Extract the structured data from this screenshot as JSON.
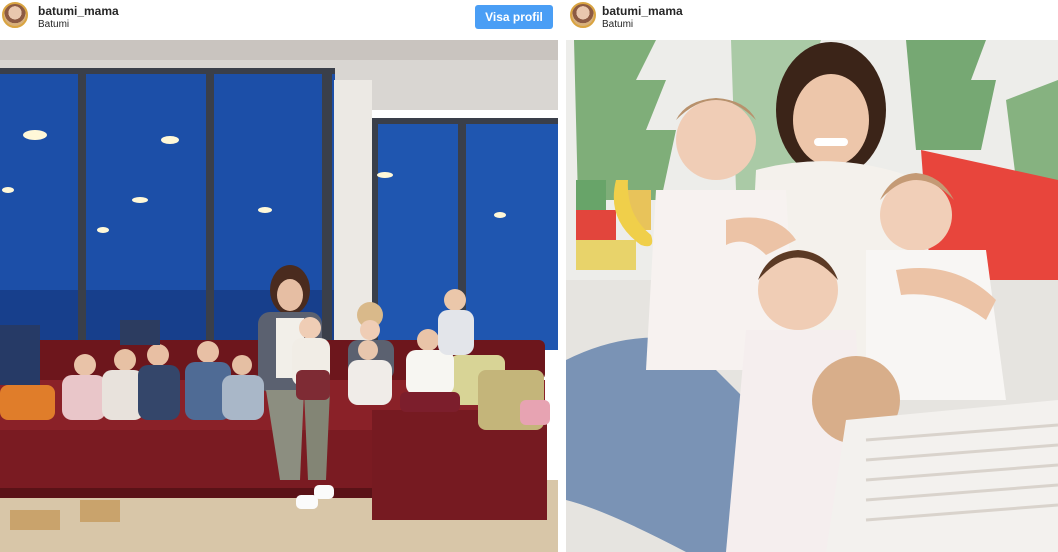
{
  "posts": [
    {
      "username": "batumi_mama",
      "location": "Batumi",
      "follow_label": "Visa profil",
      "photo_icon": "family-on-red-sofa-photo"
    },
    {
      "username": "batumi_mama",
      "location": "Batumi",
      "photo_icon": "mother-with-four-babies-photo"
    }
  ],
  "colors": {
    "follow_button": "#4a9ef5",
    "sofa": "#7e1e24",
    "window_night": "#1c4fa8"
  }
}
